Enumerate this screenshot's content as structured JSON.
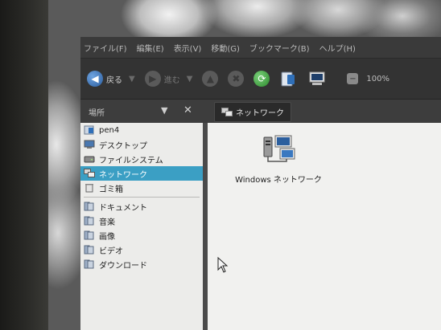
{
  "menubar": {
    "items": [
      "ファイル(F)",
      "編集(E)",
      "表示(V)",
      "移動(G)",
      "ブックマーク(B)",
      "ヘルプ(H)"
    ]
  },
  "toolbar": {
    "back_label": "戻る",
    "forward_label": "進む",
    "zoom_label": "100%"
  },
  "pathbar": {
    "places_label": "場所",
    "current_location": "ネットワーク"
  },
  "sidebar": {
    "items": [
      {
        "label": "pen4",
        "icon": "home-folder-icon"
      },
      {
        "label": "デスクトップ",
        "icon": "desktop-icon"
      },
      {
        "label": "ファイルシステム",
        "icon": "drive-icon"
      },
      {
        "label": "ネットワーク",
        "icon": "network-icon",
        "selected": true
      },
      {
        "label": "ゴミ箱",
        "icon": "trash-icon"
      }
    ],
    "bookmarks": [
      {
        "label": "ドキュメント",
        "icon": "folder-icon"
      },
      {
        "label": "音楽",
        "icon": "folder-icon"
      },
      {
        "label": "画像",
        "icon": "folder-icon"
      },
      {
        "label": "ビデオ",
        "icon": "folder-icon"
      },
      {
        "label": "ダウンロード",
        "icon": "folder-icon"
      }
    ]
  },
  "content": {
    "items": [
      {
        "label": "Windows ネットワーク",
        "icon": "windows-network-icon"
      }
    ]
  },
  "colors": {
    "selection": "#3b9fc4",
    "sidebar_bg": "#ececea",
    "content_bg": "#f1f1ef",
    "window_chrome": "#3b3b3b"
  }
}
